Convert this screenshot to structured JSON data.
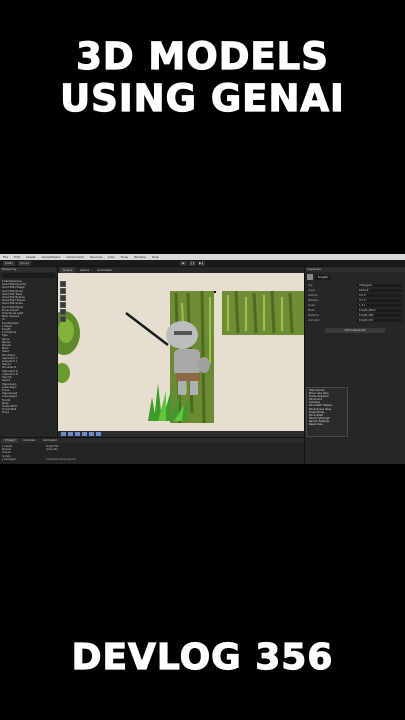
{
  "overlay": {
    "title_line_1": "3D MODELS",
    "title_line_2": "USING GENAI",
    "footer": "DEVLOG 356"
  },
  "menubar": [
    "File",
    "Edit",
    "Assets",
    "GameObject",
    "Component",
    "Services",
    "Jobs",
    "Tools",
    "Window",
    "Help"
  ],
  "toolbar": {
    "account": "DaBu",
    "cloud": "Cloud",
    "play": "▶",
    "pause": "❙❙",
    "step": "▶❙"
  },
  "hierarchy": {
    "tab": "Hierarchy",
    "rows": [
      "▾ SampleScene",
      "  Good Plat Pyramid",
      "  Good Plat Foliage",
      "  Good Plat Rocks",
      "  Good Plat Trees",
      "  Good Plat Bushes",
      "  Good Plat Flowers",
      "  Good Plat Grass",
      "  Good Plat Player",
      "  Environment",
      "  Directional Light",
      "  Main Camera",
      "  UI",
      "  EventSystem",
      "  ▾ Player",
      "    Knight",
      "    ▾ Armature",
      "      Hips",
      "      Spine",
      "      Spine1",
      "      Spine2",
      "      Neck",
      "      Head",
      "      Shoulder.L",
      "      UpperArm.L",
      "      LowerArm.L",
      "      Hand.L",
      "      Shoulder.R",
      "      UpperArm.R",
      "      LowerArm.R",
      "      Hand.R",
      "      Sword",
      "      UpperLeg.L",
      "      LowerLeg.L",
      "      Foot.L",
      "      UpperLeg.R",
      "      LowerLeg.R",
      "      Foot.R",
      "    Body",
      "  Grass Patch",
      "  Forest Wall",
      "  Props"
    ]
  },
  "scene": {
    "tabs": [
      "Scene",
      "Game",
      "Animation"
    ],
    "active_tab": "Scene"
  },
  "context_menu": [
    "Hide Gizmos",
    "Move view here",
    "Frame Selected",
    "Show Grid",
    "Overlays",
    "Show Path Helpers",
    "Show Scene View",
    "Draw Modes",
    "Show Stats",
    "Show Flythrough",
    "Render Settings",
    "Reset View"
  ],
  "inspector": {
    "tab": "Inspector",
    "object_name": "Knight",
    "rows": [
      {
        "k": "Tag",
        "v": "Untagged"
      },
      {
        "k": "Layer",
        "v": "Default"
      },
      {
        "k": "Position",
        "v": "0  0  0"
      },
      {
        "k": "Rotation",
        "v": "0  0  0"
      },
      {
        "k": "Scale",
        "v": "1  1  1"
      },
      {
        "k": "Mesh",
        "v": "Knight_Mesh"
      },
      {
        "k": "Material",
        "v": "Knight_Mat"
      },
      {
        "k": "Animator",
        "v": "Knight_Ctrl"
      }
    ],
    "add_component": "Add Component"
  },
  "bottom_panel": {
    "tabs": [
      "Project",
      "Console",
      "Animator"
    ],
    "active_tab": "Project",
    "folders": [
      "▾ Assets",
      "  Models",
      "  Scenes",
      "  Scripts",
      "▸ Packages"
    ],
    "files": [
      "Knight.fbx",
      "Grass.fbx"
    ],
    "status": "Assets/Models/Knight.fbx"
  }
}
